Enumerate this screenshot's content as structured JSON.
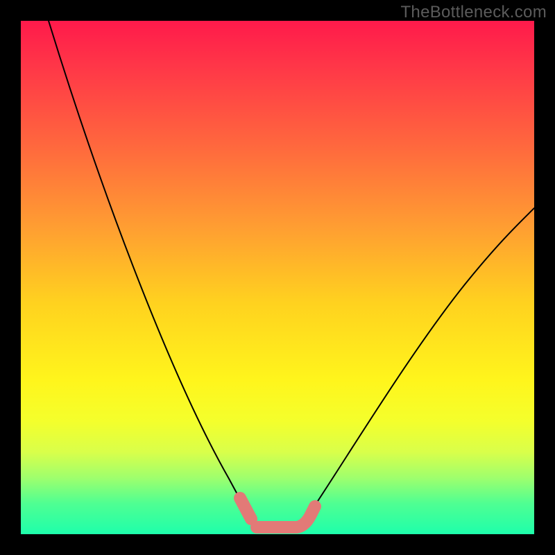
{
  "watermark_text": "TheBottleneck.com",
  "colors": {
    "background": "#000000",
    "curve": "#000000",
    "highlight": "#e27a77",
    "gradient_stops": [
      "#ff1a4b",
      "#ff3a47",
      "#ff6a3d",
      "#ff9d32",
      "#ffd21f",
      "#fff51c",
      "#f4ff2c",
      "#d9ff4a",
      "#9fff6d",
      "#4fff92",
      "#1effab"
    ]
  },
  "chart_data": {
    "type": "line",
    "title": "",
    "xlabel": "",
    "ylabel": "",
    "xlim": [
      0,
      100
    ],
    "ylim": [
      0,
      100
    ],
    "grid": false,
    "legend": false,
    "description": "A single V-shaped curve plotted over a vertical red-to-green gradient. The curve descends steeply from the top-left, reaches a flat minimum near zero at roughly x≈43–53 (highlighted with a thick salmon stroke), then rises more gently toward the upper right, ending around y≈60 at x=100.",
    "series": [
      {
        "name": "bottleneck-curve",
        "x": [
          5,
          10,
          15,
          20,
          25,
          30,
          35,
          40,
          43,
          45,
          48,
          50,
          53,
          56,
          60,
          65,
          70,
          75,
          80,
          85,
          90,
          95,
          100
        ],
        "y": [
          100,
          80,
          64,
          50,
          38,
          28,
          19,
          10,
          3,
          1,
          0,
          0,
          1,
          3,
          8,
          15,
          22,
          29,
          36,
          43,
          49,
          55,
          60
        ]
      }
    ],
    "highlight_region": {
      "x_start": 40,
      "x_end": 56
    },
    "flat_bottom": {
      "x_start": 45,
      "x_end": 53,
      "y": 0
    }
  }
}
